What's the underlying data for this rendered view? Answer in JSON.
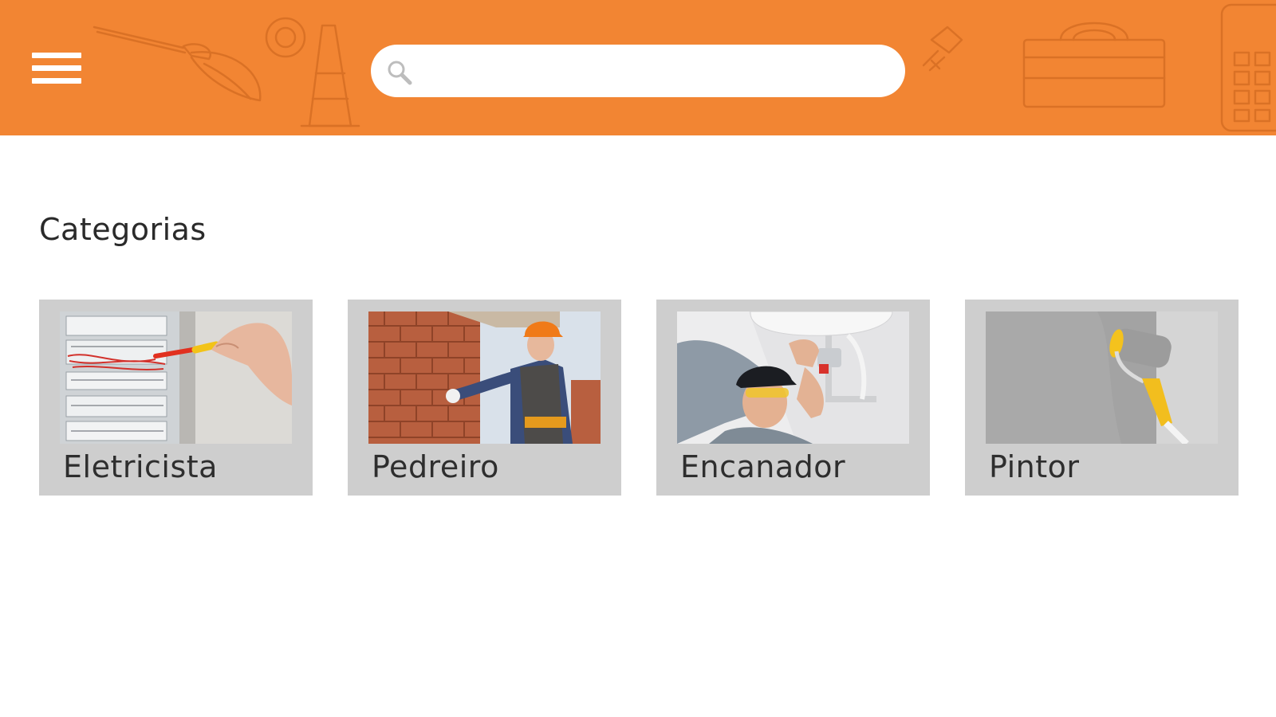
{
  "colors": {
    "header_bg": "#f28533",
    "card_bg": "#cecece",
    "page_bg": "#ffffff"
  },
  "header": {
    "menu_icon": "hamburger-menu-icon",
    "search": {
      "icon": "search-icon",
      "value": "",
      "placeholder": ""
    }
  },
  "main": {
    "title": "Categorias",
    "categories": [
      {
        "label": "Eletricista",
        "image": "electrician-working-on-fuse-box"
      },
      {
        "label": "Pedreiro",
        "image": "mason-laying-bricks"
      },
      {
        "label": "Encanador",
        "image": "plumber-fixing-pipes"
      },
      {
        "label": "Pintor",
        "image": "paint-roller-on-wall"
      }
    ]
  }
}
